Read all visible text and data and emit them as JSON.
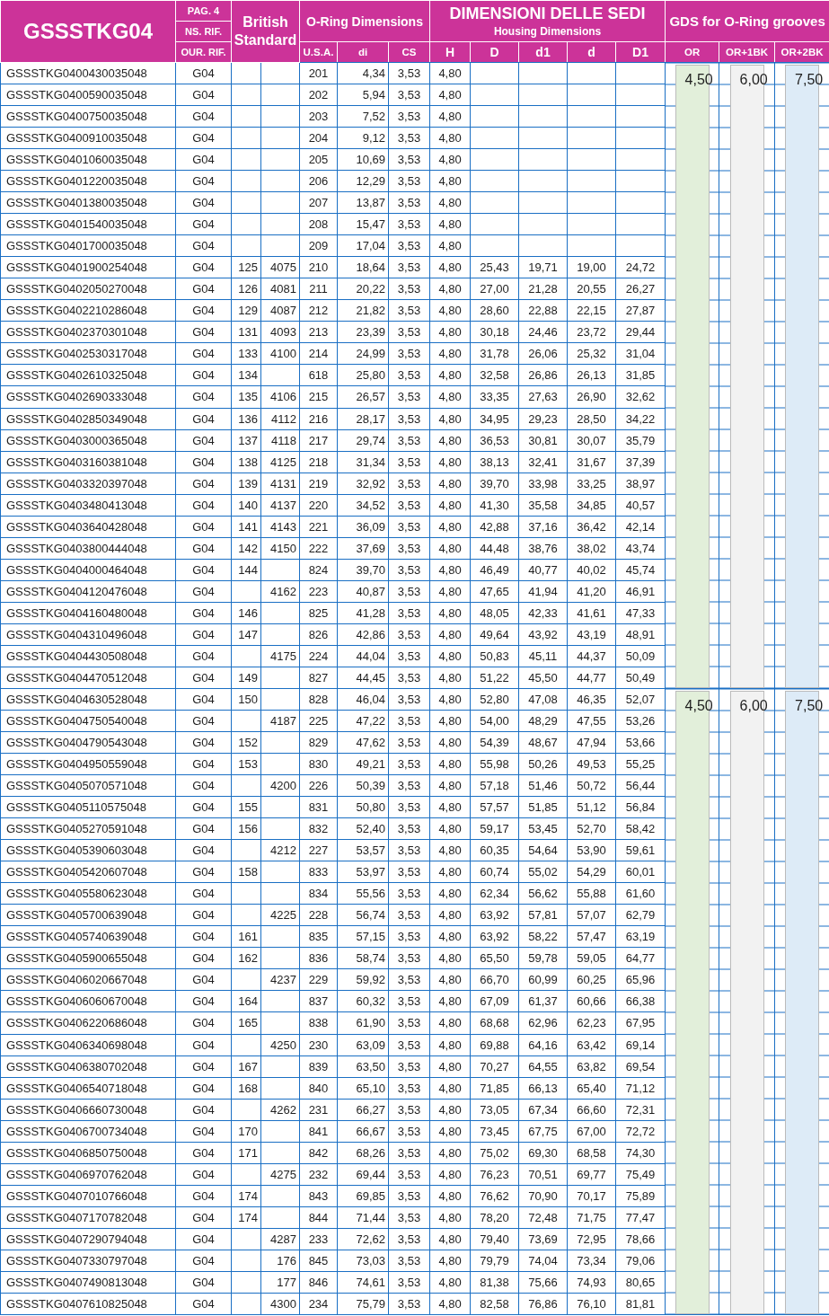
{
  "title": "GSSSTKG04",
  "ref_labels": [
    "PAG. 4",
    "NS. RIF.",
    "OUR. RIF."
  ],
  "british_standard": "British Standard",
  "oring_group": "O-Ring Dimensions",
  "housing_group": {
    "title": "DIMENSIONI DELLE SEDI",
    "subtitle": "Housing Dimensions"
  },
  "gds_group": "GDS for O-Ring grooves",
  "columns": [
    "U.S.A.",
    "di",
    "CS",
    "H",
    "D",
    "d1",
    "d",
    "D1",
    "OR",
    "OR+1BK",
    "OR+2BK"
  ],
  "rows": [
    [
      "GSSSTKG0400430035048",
      "G04",
      "",
      "",
      "201",
      "4,34",
      "3,53",
      "4,80",
      "",
      "",
      "",
      ""
    ],
    [
      "GSSSTKG0400590035048",
      "G04",
      "",
      "",
      "202",
      "5,94",
      "3,53",
      "4,80",
      "",
      "",
      "",
      ""
    ],
    [
      "GSSSTKG0400750035048",
      "G04",
      "",
      "",
      "203",
      "7,52",
      "3,53",
      "4,80",
      "",
      "",
      "",
      ""
    ],
    [
      "GSSSTKG0400910035048",
      "G04",
      "",
      "",
      "204",
      "9,12",
      "3,53",
      "4,80",
      "",
      "",
      "",
      ""
    ],
    [
      "GSSSTKG0401060035048",
      "G04",
      "",
      "",
      "205",
      "10,69",
      "3,53",
      "4,80",
      "",
      "",
      "",
      ""
    ],
    [
      "GSSSTKG0401220035048",
      "G04",
      "",
      "",
      "206",
      "12,29",
      "3,53",
      "4,80",
      "",
      "",
      "",
      ""
    ],
    [
      "GSSSTKG0401380035048",
      "G04",
      "",
      "",
      "207",
      "13,87",
      "3,53",
      "4,80",
      "",
      "",
      "",
      ""
    ],
    [
      "GSSSTKG0401540035048",
      "G04",
      "",
      "",
      "208",
      "15,47",
      "3,53",
      "4,80",
      "",
      "",
      "",
      ""
    ],
    [
      "GSSSTKG0401700035048",
      "G04",
      "",
      "",
      "209",
      "17,04",
      "3,53",
      "4,80",
      "",
      "",
      "",
      ""
    ],
    [
      "GSSSTKG0401900254048",
      "G04",
      "125",
      "4075",
      "210",
      "18,64",
      "3,53",
      "4,80",
      "25,43",
      "19,71",
      "19,00",
      "24,72"
    ],
    [
      "GSSSTKG0402050270048",
      "G04",
      "126",
      "4081",
      "211",
      "20,22",
      "3,53",
      "4,80",
      "27,00",
      "21,28",
      "20,55",
      "26,27"
    ],
    [
      "GSSSTKG0402210286048",
      "G04",
      "129",
      "4087",
      "212",
      "21,82",
      "3,53",
      "4,80",
      "28,60",
      "22,88",
      "22,15",
      "27,87"
    ],
    [
      "GSSSTKG0402370301048",
      "G04",
      "131",
      "4093",
      "213",
      "23,39",
      "3,53",
      "4,80",
      "30,18",
      "24,46",
      "23,72",
      "29,44"
    ],
    [
      "GSSSTKG0402530317048",
      "G04",
      "133",
      "4100",
      "214",
      "24,99",
      "3,53",
      "4,80",
      "31,78",
      "26,06",
      "25,32",
      "31,04"
    ],
    [
      "GSSSTKG0402610325048",
      "G04",
      "134",
      "",
      "618",
      "25,80",
      "3,53",
      "4,80",
      "32,58",
      "26,86",
      "26,13",
      "31,85"
    ],
    [
      "GSSSTKG0402690333048",
      "G04",
      "135",
      "4106",
      "215",
      "26,57",
      "3,53",
      "4,80",
      "33,35",
      "27,63",
      "26,90",
      "32,62"
    ],
    [
      "GSSSTKG0402850349048",
      "G04",
      "136",
      "4112",
      "216",
      "28,17",
      "3,53",
      "4,80",
      "34,95",
      "29,23",
      "28,50",
      "34,22"
    ],
    [
      "GSSSTKG0403000365048",
      "G04",
      "137",
      "4118",
      "217",
      "29,74",
      "3,53",
      "4,80",
      "36,53",
      "30,81",
      "30,07",
      "35,79"
    ],
    [
      "GSSSTKG0403160381048",
      "G04",
      "138",
      "4125",
      "218",
      "31,34",
      "3,53",
      "4,80",
      "38,13",
      "32,41",
      "31,67",
      "37,39"
    ],
    [
      "GSSSTKG0403320397048",
      "G04",
      "139",
      "4131",
      "219",
      "32,92",
      "3,53",
      "4,80",
      "39,70",
      "33,98",
      "33,25",
      "38,97"
    ],
    [
      "GSSSTKG0403480413048",
      "G04",
      "140",
      "4137",
      "220",
      "34,52",
      "3,53",
      "4,80",
      "41,30",
      "35,58",
      "34,85",
      "40,57"
    ],
    [
      "GSSSTKG0403640428048",
      "G04",
      "141",
      "4143",
      "221",
      "36,09",
      "3,53",
      "4,80",
      "42,88",
      "37,16",
      "36,42",
      "42,14"
    ],
    [
      "GSSSTKG0403800444048",
      "G04",
      "142",
      "4150",
      "222",
      "37,69",
      "3,53",
      "4,80",
      "44,48",
      "38,76",
      "38,02",
      "43,74"
    ],
    [
      "GSSSTKG0404000464048",
      "G04",
      "144",
      "",
      "824",
      "39,70",
      "3,53",
      "4,80",
      "46,49",
      "40,77",
      "40,02",
      "45,74"
    ],
    [
      "GSSSTKG0404120476048",
      "G04",
      "",
      "4162",
      "223",
      "40,87",
      "3,53",
      "4,80",
      "47,65",
      "41,94",
      "41,20",
      "46,91"
    ],
    [
      "GSSSTKG0404160480048",
      "G04",
      "146",
      "",
      "825",
      "41,28",
      "3,53",
      "4,80",
      "48,05",
      "42,33",
      "41,61",
      "47,33"
    ],
    [
      "GSSSTKG0404310496048",
      "G04",
      "147",
      "",
      "826",
      "42,86",
      "3,53",
      "4,80",
      "49,64",
      "43,92",
      "43,19",
      "48,91"
    ],
    [
      "GSSSTKG0404430508048",
      "G04",
      "",
      "4175",
      "224",
      "44,04",
      "3,53",
      "4,80",
      "50,83",
      "45,11",
      "44,37",
      "50,09"
    ],
    [
      "GSSSTKG0404470512048",
      "G04",
      "149",
      "",
      "827",
      "44,45",
      "3,53",
      "4,80",
      "51,22",
      "45,50",
      "44,77",
      "50,49"
    ],
    [
      "GSSSTKG0404630528048",
      "G04",
      "150",
      "",
      "828",
      "46,04",
      "3,53",
      "4,80",
      "52,80",
      "47,08",
      "46,35",
      "52,07"
    ],
    [
      "GSSSTKG0404750540048",
      "G04",
      "",
      "4187",
      "225",
      "47,22",
      "3,53",
      "4,80",
      "54,00",
      "48,29",
      "47,55",
      "53,26"
    ],
    [
      "GSSSTKG0404790543048",
      "G04",
      "152",
      "",
      "829",
      "47,62",
      "3,53",
      "4,80",
      "54,39",
      "48,67",
      "47,94",
      "53,66"
    ],
    [
      "GSSSTKG0404950559048",
      "G04",
      "153",
      "",
      "830",
      "49,21",
      "3,53",
      "4,80",
      "55,98",
      "50,26",
      "49,53",
      "55,25"
    ],
    [
      "GSSSTKG0405070571048",
      "G04",
      "",
      "4200",
      "226",
      "50,39",
      "3,53",
      "4,80",
      "57,18",
      "51,46",
      "50,72",
      "56,44"
    ],
    [
      "GSSSTKG0405110575048",
      "G04",
      "155",
      "",
      "831",
      "50,80",
      "3,53",
      "4,80",
      "57,57",
      "51,85",
      "51,12",
      "56,84"
    ],
    [
      "GSSSTKG0405270591048",
      "G04",
      "156",
      "",
      "832",
      "52,40",
      "3,53",
      "4,80",
      "59,17",
      "53,45",
      "52,70",
      "58,42"
    ],
    [
      "GSSSTKG0405390603048",
      "G04",
      "",
      "4212",
      "227",
      "53,57",
      "3,53",
      "4,80",
      "60,35",
      "54,64",
      "53,90",
      "59,61"
    ],
    [
      "GSSSTKG0405420607048",
      "G04",
      "158",
      "",
      "833",
      "53,97",
      "3,53",
      "4,80",
      "60,74",
      "55,02",
      "54,29",
      "60,01"
    ],
    [
      "GSSSTKG0405580623048",
      "G04",
      "",
      "",
      "834",
      "55,56",
      "3,53",
      "4,80",
      "62,34",
      "56,62",
      "55,88",
      "61,60"
    ],
    [
      "GSSSTKG0405700639048",
      "G04",
      "",
      "4225",
      "228",
      "56,74",
      "3,53",
      "4,80",
      "63,92",
      "57,81",
      "57,07",
      "62,79"
    ],
    [
      "GSSSTKG0405740639048",
      "G04",
      "161",
      "",
      "835",
      "57,15",
      "3,53",
      "4,80",
      "63,92",
      "58,22",
      "57,47",
      "63,19"
    ],
    [
      "GSSSTKG0405900655048",
      "G04",
      "162",
      "",
      "836",
      "58,74",
      "3,53",
      "4,80",
      "65,50",
      "59,78",
      "59,05",
      "64,77"
    ],
    [
      "GSSSTKG0406020667048",
      "G04",
      "",
      "4237",
      "229",
      "59,92",
      "3,53",
      "4,80",
      "66,70",
      "60,99",
      "60,25",
      "65,96"
    ],
    [
      "GSSSTKG0406060670048",
      "G04",
      "164",
      "",
      "837",
      "60,32",
      "3,53",
      "4,80",
      "67,09",
      "61,37",
      "60,66",
      "66,38"
    ],
    [
      "GSSSTKG0406220686048",
      "G04",
      "165",
      "",
      "838",
      "61,90",
      "3,53",
      "4,80",
      "68,68",
      "62,96",
      "62,23",
      "67,95"
    ],
    [
      "GSSSTKG0406340698048",
      "G04",
      "",
      "4250",
      "230",
      "63,09",
      "3,53",
      "4,80",
      "69,88",
      "64,16",
      "63,42",
      "69,14"
    ],
    [
      "GSSSTKG0406380702048",
      "G04",
      "167",
      "",
      "839",
      "63,50",
      "3,53",
      "4,80",
      "70,27",
      "64,55",
      "63,82",
      "69,54"
    ],
    [
      "GSSSTKG0406540718048",
      "G04",
      "168",
      "",
      "840",
      "65,10",
      "3,53",
      "4,80",
      "71,85",
      "66,13",
      "65,40",
      "71,12"
    ],
    [
      "GSSSTKG0406660730048",
      "G04",
      "",
      "4262",
      "231",
      "66,27",
      "3,53",
      "4,80",
      "73,05",
      "67,34",
      "66,60",
      "72,31"
    ],
    [
      "GSSSTKG0406700734048",
      "G04",
      "170",
      "",
      "841",
      "66,67",
      "3,53",
      "4,80",
      "73,45",
      "67,75",
      "67,00",
      "72,72"
    ],
    [
      "GSSSTKG0406850750048",
      "G04",
      "171",
      "",
      "842",
      "68,26",
      "3,53",
      "4,80",
      "75,02",
      "69,30",
      "68,58",
      "74,30"
    ],
    [
      "GSSSTKG0406970762048",
      "G04",
      "",
      "4275",
      "232",
      "69,44",
      "3,53",
      "4,80",
      "76,23",
      "70,51",
      "69,77",
      "75,49"
    ],
    [
      "GSSSTKG0407010766048",
      "G04",
      "174",
      "",
      "843",
      "69,85",
      "3,53",
      "4,80",
      "76,62",
      "70,90",
      "70,17",
      "75,89"
    ],
    [
      "GSSSTKG0407170782048",
      "G04",
      "174",
      "",
      "844",
      "71,44",
      "3,53",
      "4,80",
      "78,20",
      "72,48",
      "71,75",
      "77,47"
    ],
    [
      "GSSSTKG0407290794048",
      "G04",
      "",
      "4287",
      "233",
      "72,62",
      "3,53",
      "4,80",
      "79,40",
      "73,69",
      "72,95",
      "78,66"
    ],
    [
      "GSSSTKG0407330797048",
      "G04",
      "",
      "176",
      "845",
      "73,03",
      "3,53",
      "4,80",
      "79,79",
      "74,04",
      "73,34",
      "79,06"
    ],
    [
      "GSSSTKG0407490813048",
      "G04",
      "",
      "177",
      "846",
      "74,61",
      "3,53",
      "4,80",
      "81,38",
      "75,66",
      "74,93",
      "80,65"
    ],
    [
      "GSSSTKG0407610825048",
      "G04",
      "",
      "4300",
      "234",
      "75,79",
      "3,53",
      "4,80",
      "82,58",
      "76,86",
      "76,10",
      "81,81"
    ]
  ],
  "groove_groups": [
    {
      "values": [
        {
          "text": "4,50",
          "color": "#e2efda"
        },
        {
          "text": "6,00",
          "color": "#f2f2f2"
        },
        {
          "text": "7,50",
          "color": "#ddebf7"
        }
      ]
    },
    {
      "values": [
        {
          "text": "4,50",
          "color": "#e2efda"
        },
        {
          "text": "6,00",
          "color": "#f2f2f2"
        },
        {
          "text": "7,50",
          "color": "#ddebf7"
        }
      ]
    }
  ]
}
